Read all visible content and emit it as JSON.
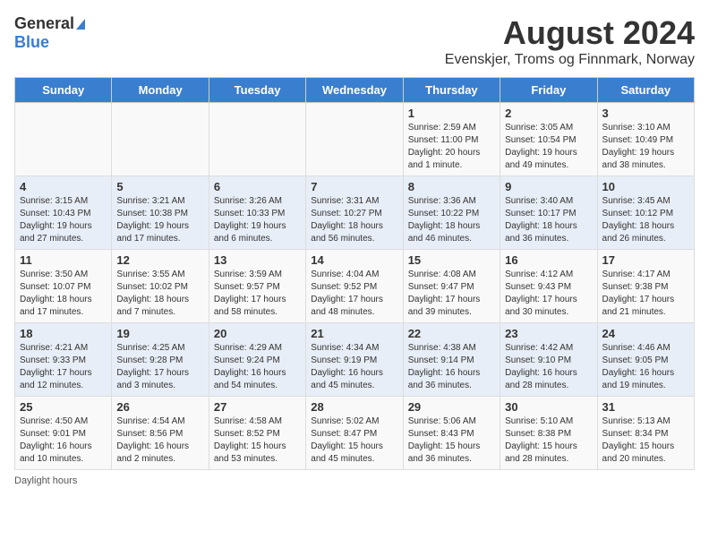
{
  "header": {
    "logo_general": "General",
    "logo_blue": "Blue",
    "title": "August 2024",
    "subtitle": "Evenskjer, Troms og Finnmark, Norway"
  },
  "columns": [
    "Sunday",
    "Monday",
    "Tuesday",
    "Wednesday",
    "Thursday",
    "Friday",
    "Saturday"
  ],
  "weeks": [
    [
      {
        "day": "",
        "info": ""
      },
      {
        "day": "",
        "info": ""
      },
      {
        "day": "",
        "info": ""
      },
      {
        "day": "",
        "info": ""
      },
      {
        "day": "1",
        "info": "Sunrise: 2:59 AM\nSunset: 11:00 PM\nDaylight: 20 hours\nand 1 minute."
      },
      {
        "day": "2",
        "info": "Sunrise: 3:05 AM\nSunset: 10:54 PM\nDaylight: 19 hours\nand 49 minutes."
      },
      {
        "day": "3",
        "info": "Sunrise: 3:10 AM\nSunset: 10:49 PM\nDaylight: 19 hours\nand 38 minutes."
      }
    ],
    [
      {
        "day": "4",
        "info": "Sunrise: 3:15 AM\nSunset: 10:43 PM\nDaylight: 19 hours\nand 27 minutes."
      },
      {
        "day": "5",
        "info": "Sunrise: 3:21 AM\nSunset: 10:38 PM\nDaylight: 19 hours\nand 17 minutes."
      },
      {
        "day": "6",
        "info": "Sunrise: 3:26 AM\nSunset: 10:33 PM\nDaylight: 19 hours\nand 6 minutes."
      },
      {
        "day": "7",
        "info": "Sunrise: 3:31 AM\nSunset: 10:27 PM\nDaylight: 18 hours\nand 56 minutes."
      },
      {
        "day": "8",
        "info": "Sunrise: 3:36 AM\nSunset: 10:22 PM\nDaylight: 18 hours\nand 46 minutes."
      },
      {
        "day": "9",
        "info": "Sunrise: 3:40 AM\nSunset: 10:17 PM\nDaylight: 18 hours\nand 36 minutes."
      },
      {
        "day": "10",
        "info": "Sunrise: 3:45 AM\nSunset: 10:12 PM\nDaylight: 18 hours\nand 26 minutes."
      }
    ],
    [
      {
        "day": "11",
        "info": "Sunrise: 3:50 AM\nSunset: 10:07 PM\nDaylight: 18 hours\nand 17 minutes."
      },
      {
        "day": "12",
        "info": "Sunrise: 3:55 AM\nSunset: 10:02 PM\nDaylight: 18 hours\nand 7 minutes."
      },
      {
        "day": "13",
        "info": "Sunrise: 3:59 AM\nSunset: 9:57 PM\nDaylight: 17 hours\nand 58 minutes."
      },
      {
        "day": "14",
        "info": "Sunrise: 4:04 AM\nSunset: 9:52 PM\nDaylight: 17 hours\nand 48 minutes."
      },
      {
        "day": "15",
        "info": "Sunrise: 4:08 AM\nSunset: 9:47 PM\nDaylight: 17 hours\nand 39 minutes."
      },
      {
        "day": "16",
        "info": "Sunrise: 4:12 AM\nSunset: 9:43 PM\nDaylight: 17 hours\nand 30 minutes."
      },
      {
        "day": "17",
        "info": "Sunrise: 4:17 AM\nSunset: 9:38 PM\nDaylight: 17 hours\nand 21 minutes."
      }
    ],
    [
      {
        "day": "18",
        "info": "Sunrise: 4:21 AM\nSunset: 9:33 PM\nDaylight: 17 hours\nand 12 minutes."
      },
      {
        "day": "19",
        "info": "Sunrise: 4:25 AM\nSunset: 9:28 PM\nDaylight: 17 hours\nand 3 minutes."
      },
      {
        "day": "20",
        "info": "Sunrise: 4:29 AM\nSunset: 9:24 PM\nDaylight: 16 hours\nand 54 minutes."
      },
      {
        "day": "21",
        "info": "Sunrise: 4:34 AM\nSunset: 9:19 PM\nDaylight: 16 hours\nand 45 minutes."
      },
      {
        "day": "22",
        "info": "Sunrise: 4:38 AM\nSunset: 9:14 PM\nDaylight: 16 hours\nand 36 minutes."
      },
      {
        "day": "23",
        "info": "Sunrise: 4:42 AM\nSunset: 9:10 PM\nDaylight: 16 hours\nand 28 minutes."
      },
      {
        "day": "24",
        "info": "Sunrise: 4:46 AM\nSunset: 9:05 PM\nDaylight: 16 hours\nand 19 minutes."
      }
    ],
    [
      {
        "day": "25",
        "info": "Sunrise: 4:50 AM\nSunset: 9:01 PM\nDaylight: 16 hours\nand 10 minutes."
      },
      {
        "day": "26",
        "info": "Sunrise: 4:54 AM\nSunset: 8:56 PM\nDaylight: 16 hours\nand 2 minutes."
      },
      {
        "day": "27",
        "info": "Sunrise: 4:58 AM\nSunset: 8:52 PM\nDaylight: 15 hours\nand 53 minutes."
      },
      {
        "day": "28",
        "info": "Sunrise: 5:02 AM\nSunset: 8:47 PM\nDaylight: 15 hours\nand 45 minutes."
      },
      {
        "day": "29",
        "info": "Sunrise: 5:06 AM\nSunset: 8:43 PM\nDaylight: 15 hours\nand 36 minutes."
      },
      {
        "day": "30",
        "info": "Sunrise: 5:10 AM\nSunset: 8:38 PM\nDaylight: 15 hours\nand 28 minutes."
      },
      {
        "day": "31",
        "info": "Sunrise: 5:13 AM\nSunset: 8:34 PM\nDaylight: 15 hours\nand 20 minutes."
      }
    ]
  ],
  "footer": "Daylight hours"
}
